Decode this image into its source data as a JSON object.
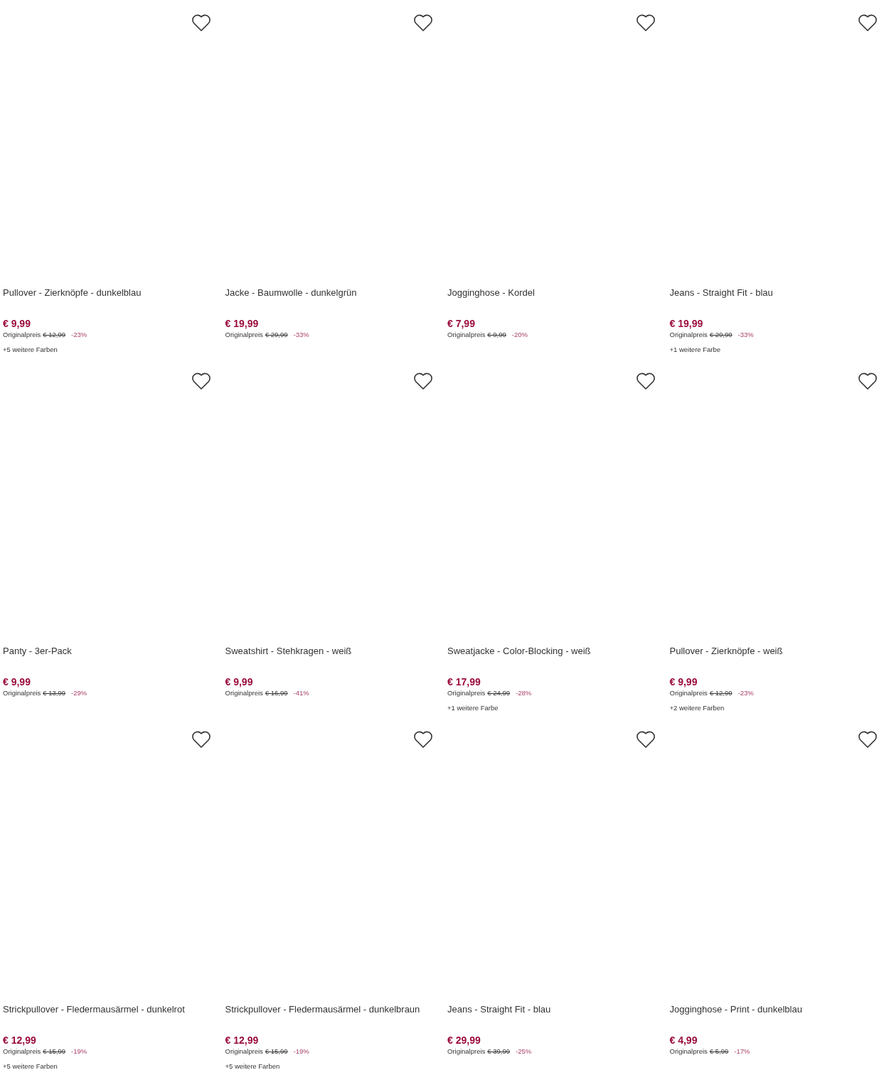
{
  "products": [
    {
      "title": "Pullover - Zierknöpfe - dunkelblau",
      "price": "€ 9,99",
      "original_label": "Originalpreis",
      "original_price": "€ 12,99",
      "discount": "-23%",
      "more_colors": "+5 weitere Farben"
    },
    {
      "title": "Jacke - Baumwolle - dunkelgrün",
      "price": "€ 19,99",
      "original_label": "Originalpreis",
      "original_price": "€ 29,99",
      "discount": "-33%"
    },
    {
      "title": "Jogginghose - Kordel",
      "price": "€ 7,99",
      "original_label": "Originalpreis",
      "original_price": "€ 9,99",
      "discount": "-20%"
    },
    {
      "title": "Jeans - Straight Fit - blau",
      "price": "€ 19,99",
      "original_label": "Originalpreis",
      "original_price": "€ 29,99",
      "discount": "-33%",
      "more_colors": "+1 weitere Farbe"
    },
    {
      "title": "Panty - 3er-Pack",
      "price": "€ 9,99",
      "original_label": "Originalpreis",
      "original_price": "€ 13,99",
      "discount": "-29%"
    },
    {
      "title": "Sweatshirt - Stehkragen - weiß",
      "price": "€ 9,99",
      "original_label": "Originalpreis",
      "original_price": "€ 16,99",
      "discount": "-41%"
    },
    {
      "title": "Sweatjacke - Color-Blocking - weiß",
      "price": "€ 17,99",
      "original_label": "Originalpreis",
      "original_price": "€ 24,99",
      "discount": "-28%",
      "more_colors": "+1 weitere Farbe"
    },
    {
      "title": "Pullover - Zierknöpfe - weiß",
      "price": "€ 9,99",
      "original_label": "Originalpreis",
      "original_price": "€ 12,99",
      "discount": "-23%",
      "more_colors": "+2 weitere Farben"
    },
    {
      "title": "Strickpullover - Fledermausärmel - dunkelrot",
      "price": "€ 12,99",
      "original_label": "Originalpreis",
      "original_price": "€ 15,99",
      "discount": "-19%",
      "more_colors": "+5 weitere Farben"
    },
    {
      "title": "Strickpullover - Fledermausärmel - dunkelbraun",
      "price": "€ 12,99",
      "original_label": "Originalpreis",
      "original_price": "€ 15,99",
      "discount": "-19%",
      "more_colors": "+5 weitere Farben"
    },
    {
      "title": "Jeans - Straight Fit - blau",
      "price": "€ 29,99",
      "original_label": "Originalpreis",
      "original_price": "€ 39,99",
      "discount": "-25%"
    },
    {
      "title": "Jogginghose - Print - dunkelblau",
      "price": "€ 4,99",
      "original_label": "Originalpreis",
      "original_price": "€ 5,99",
      "discount": "-17%"
    }
  ]
}
